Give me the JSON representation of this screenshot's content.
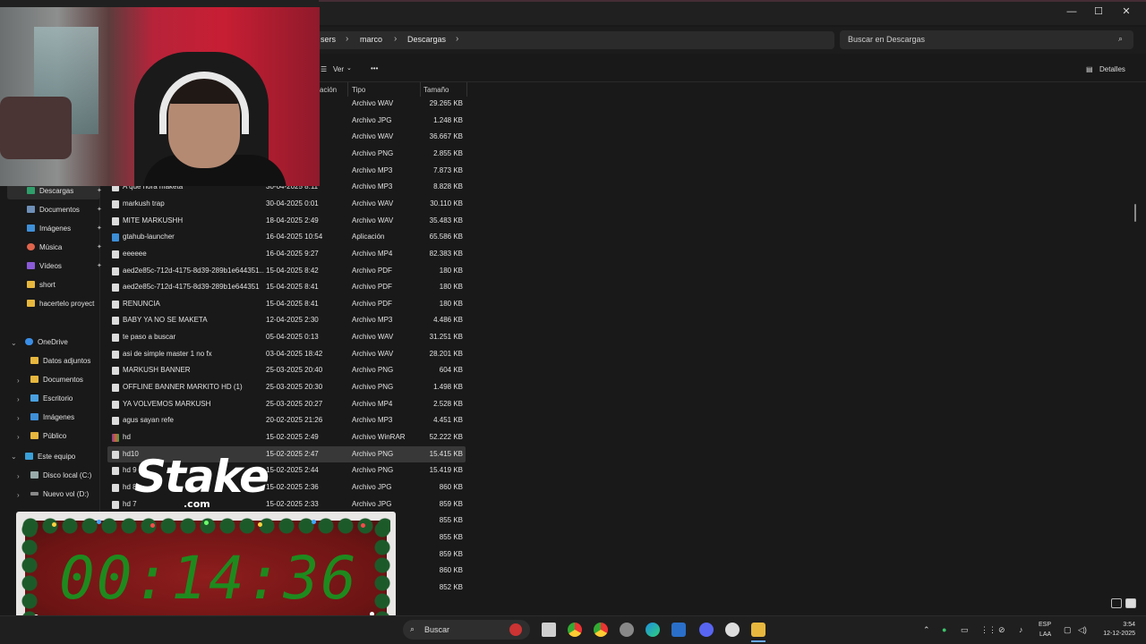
{
  "window": {
    "minimize": "—",
    "maximize": "☐",
    "close": "✕"
  },
  "address": {
    "crumbs": [
      "sers",
      "marco",
      "Descargas"
    ],
    "search_placeholder": "Buscar en Descargas"
  },
  "toolbar": {
    "view_label": "Ver",
    "more_label": "•••",
    "details_label": "Detalles"
  },
  "columns": {
    "date_partial": "ación",
    "type": "Tipo",
    "size": "Tamaño"
  },
  "sidebar": {
    "quick": [
      {
        "label": "Descargas",
        "icon": "download-icon",
        "pinned": true,
        "selected": true
      },
      {
        "label": "Documentos",
        "icon": "document-icon",
        "pinned": true
      },
      {
        "label": "Imágenes",
        "icon": "image-icon",
        "pinned": true
      },
      {
        "label": "Música",
        "icon": "music-icon",
        "pinned": true
      },
      {
        "label": "Vídeos",
        "icon": "video-icon",
        "pinned": true
      },
      {
        "label": "short",
        "icon": "folder-icon"
      },
      {
        "label": "hacertelo proyect",
        "icon": "folder-icon"
      }
    ],
    "onedrive": {
      "label": "OneDrive",
      "children": [
        "Datos adjuntos",
        "Documentos",
        "Escritorio",
        "Imágenes",
        "Público"
      ]
    },
    "pc": {
      "label": "Este equipo",
      "children": [
        "Disco local (C:)",
        "Nuevo vol (D:)"
      ]
    }
  },
  "files": [
    {
      "name": "",
      "date": "",
      "type": "Archivo WAV",
      "size": "29.265 KB"
    },
    {
      "name": "",
      "date": "",
      "type": "Archivo JPG",
      "size": "1.248 KB"
    },
    {
      "name": "",
      "date": "",
      "type": "Archivo WAV",
      "size": "36.667 KB"
    },
    {
      "name": "",
      "date": "",
      "type": "Archivo PNG",
      "size": "2.855 KB"
    },
    {
      "name": "",
      "date": "",
      "type": "Archivo MP3",
      "size": "7.873 KB"
    },
    {
      "name": "A que hora maketa",
      "date": "30-04-2025 8:11",
      "type": "Archivo MP3",
      "size": "8.828 KB"
    },
    {
      "name": "markush trap",
      "date": "30-04-2025 0:01",
      "type": "Archivo WAV",
      "size": "30.110 KB"
    },
    {
      "name": "MITE MARKUSHH",
      "date": "18-04-2025 2:49",
      "type": "Archivo WAV",
      "size": "35.483 KB"
    },
    {
      "name": "gtahub-launcher",
      "date": "16-04-2025 10:54",
      "type": "Aplicación",
      "size": "65.586 KB",
      "kind": "app"
    },
    {
      "name": "eeeeee",
      "date": "16-04-2025 9:27",
      "type": "Archivo MP4",
      "size": "82.383 KB"
    },
    {
      "name": "aed2e85c-712d-4175-8d39-289b1e644351...",
      "date": "15-04-2025 8:42",
      "type": "Archivo PDF",
      "size": "180 KB"
    },
    {
      "name": "aed2e85c-712d-4175-8d39-289b1e644351",
      "date": "15-04-2025 8:41",
      "type": "Archivo PDF",
      "size": "180 KB"
    },
    {
      "name": "RENUNCIA",
      "date": "15-04-2025 8:41",
      "type": "Archivo PDF",
      "size": "180 KB"
    },
    {
      "name": "BABY YA NO SE MAKETA",
      "date": "12-04-2025 2:30",
      "type": "Archivo MP3",
      "size": "4.486 KB"
    },
    {
      "name": "te paso a buscar",
      "date": "05-04-2025 0:13",
      "type": "Archivo WAV",
      "size": "31.251 KB"
    },
    {
      "name": "asi de simple master 1 no fx",
      "date": "03-04-2025 18:42",
      "type": "Archivo WAV",
      "size": "28.201 KB"
    },
    {
      "name": "MARKUSH BANNER",
      "date": "25-03-2025 20:40",
      "type": "Archivo PNG",
      "size": "604 KB"
    },
    {
      "name": "OFFLINE BANNER MARKITO HD (1)",
      "date": "25-03-2025 20:30",
      "type": "Archivo PNG",
      "size": "1.498 KB"
    },
    {
      "name": "YA VOLVEMOS MARKUSH",
      "date": "25-03-2025 20:27",
      "type": "Archivo MP4",
      "size": "2.528 KB"
    },
    {
      "name": "agus sayan refe",
      "date": "20-02-2025 21:26",
      "type": "Archivo MP3",
      "size": "4.451 KB"
    },
    {
      "name": "hd",
      "date": "15-02-2025 2:49",
      "type": "Archivo WinRAR",
      "size": "52.222 KB",
      "kind": "rar"
    },
    {
      "name": "hd10",
      "date": "15-02-2025 2:47",
      "type": "Archivo PNG",
      "size": "15.415 KB",
      "selected": true
    },
    {
      "name": "hd 9",
      "date": "15-02-2025 2:44",
      "type": "Archivo PNG",
      "size": "15.419 KB"
    },
    {
      "name": "hd 8",
      "date": "15-02-2025 2:36",
      "type": "Archivo JPG",
      "size": "860 KB"
    },
    {
      "name": "hd 7",
      "date": "15-02-2025 2:33",
      "type": "Archivo JPG",
      "size": "859 KB"
    },
    {
      "name": "",
      "date": "",
      "type": "",
      "size": "855 KB"
    },
    {
      "name": "",
      "date": "",
      "type": "",
      "size": "855 KB"
    },
    {
      "name": "",
      "date": "",
      "type": "",
      "size": "859 KB"
    },
    {
      "name": "",
      "date": "",
      "type": "",
      "size": "860 KB"
    },
    {
      "name": "",
      "date": "",
      "type": "",
      "size": "852 KB"
    }
  ],
  "overlay": {
    "brand": "Stake",
    "brand_domain": ".com",
    "timer": "00:14:36",
    "timer_color": "#1e8a1e"
  },
  "taskbar": {
    "search_label": "Buscar",
    "lang_top": "ESP",
    "lang_bottom": "LAA",
    "time": "3:54",
    "date": "12-12-2025"
  }
}
